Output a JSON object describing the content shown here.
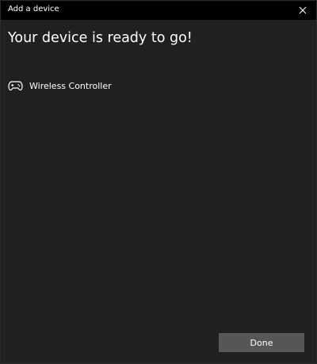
{
  "window": {
    "title": "Add a device",
    "close_icon": "close-icon"
  },
  "main": {
    "heading": "Your device is ready to go!",
    "devices": [
      {
        "icon": "gamepad-icon",
        "label": "Wireless Controller"
      }
    ]
  },
  "footer": {
    "done_label": "Done"
  },
  "colors": {
    "titlebar_bg": "#000000",
    "window_bg": "#202020",
    "button_bg": "#575757",
    "text": "#ffffff"
  }
}
